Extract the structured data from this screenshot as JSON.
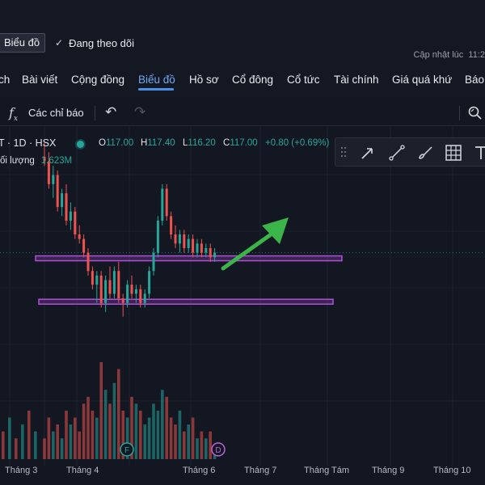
{
  "header": {
    "chart_button": "Biểu đồ",
    "follow_label": "Đang theo dõi",
    "updated_label": "Cập nhật lúc",
    "updated_time": "11:2"
  },
  "nav": {
    "tabs": [
      {
        "label": "ch",
        "active": false
      },
      {
        "label": "Bài viết",
        "active": false
      },
      {
        "label": "Cộng đồng",
        "active": false
      },
      {
        "label": "Biểu đồ",
        "active": true
      },
      {
        "label": "Hồ sơ",
        "active": false
      },
      {
        "label": "Cổ đông",
        "active": false
      },
      {
        "label": "Cổ tức",
        "active": false
      },
      {
        "label": "Tài chính",
        "active": false
      },
      {
        "label": "Giá quá khứ",
        "active": false
      },
      {
        "label": "Báo",
        "active": false
      }
    ]
  },
  "toolbar": {
    "indicators_label": "Các chỉ báo",
    "icons": [
      "function-icon",
      "undo-icon",
      "redo-icon",
      "zoom-icon"
    ]
  },
  "legend": {
    "symbol": "T · 1D · HSX",
    "open_label": "O",
    "open": "117.00",
    "high_label": "H",
    "high": "117.40",
    "low_label": "L",
    "low": "116.20",
    "close_label": "C",
    "close": "117.00",
    "change": "+0.80 (+0.69%)",
    "volume_label": "ối lượng",
    "volume": "1.623M"
  },
  "drawing_tools": [
    "arrow-tool-icon",
    "trend-line-icon",
    "brush-icon",
    "grid-icon",
    "text-icon"
  ],
  "colors": {
    "up": "#26a69a",
    "down": "#ef5350",
    "zone": "#b14fd8",
    "arrow": "#3bb44a",
    "active_tab": "#6ea9ef"
  },
  "chart_data": {
    "type": "candlestick",
    "x_labels": [
      "Tháng 3",
      "Tháng 4",
      "Tháng 6",
      "Tháng 7",
      "Tháng Tám",
      "Tháng 9",
      "Tháng 10"
    ],
    "event_markers": [
      "F",
      "D"
    ],
    "candles": [
      {
        "o": 128,
        "h": 131,
        "l": 126,
        "c": 127
      },
      {
        "o": 127,
        "h": 129,
        "l": 121,
        "c": 122
      },
      {
        "o": 122,
        "h": 126,
        "l": 119,
        "c": 124
      },
      {
        "o": 124,
        "h": 125,
        "l": 116,
        "c": 117
      },
      {
        "o": 117,
        "h": 121,
        "l": 115,
        "c": 120
      },
      {
        "o": 120,
        "h": 122,
        "l": 113,
        "c": 114
      },
      {
        "o": 114,
        "h": 118,
        "l": 112,
        "c": 116
      },
      {
        "o": 116,
        "h": 117,
        "l": 110,
        "c": 111
      },
      {
        "o": 111,
        "h": 113,
        "l": 109,
        "c": 110
      },
      {
        "o": 110,
        "h": 111,
        "l": 106,
        "c": 107
      },
      {
        "o": 107,
        "h": 108,
        "l": 102,
        "c": 103
      },
      {
        "o": 103,
        "h": 104,
        "l": 99,
        "c": 100
      },
      {
        "o": 100,
        "h": 103,
        "l": 96,
        "c": 102
      },
      {
        "o": 102,
        "h": 103,
        "l": 95,
        "c": 96
      },
      {
        "o": 96,
        "h": 102,
        "l": 94,
        "c": 101
      },
      {
        "o": 101,
        "h": 104,
        "l": 97,
        "c": 98
      },
      {
        "o": 98,
        "h": 104,
        "l": 97,
        "c": 103
      },
      {
        "o": 103,
        "h": 105,
        "l": 96,
        "c": 97
      },
      {
        "o": 97,
        "h": 98,
        "l": 93,
        "c": 96
      },
      {
        "o": 96,
        "h": 101,
        "l": 95,
        "c": 100
      },
      {
        "o": 100,
        "h": 102,
        "l": 97,
        "c": 98
      },
      {
        "o": 98,
        "h": 100,
        "l": 96,
        "c": 99
      },
      {
        "o": 99,
        "h": 100,
        "l": 95,
        "c": 96
      },
      {
        "o": 96,
        "h": 99,
        "l": 95,
        "c": 98
      },
      {
        "o": 98,
        "h": 104,
        "l": 97,
        "c": 103
      },
      {
        "o": 103,
        "h": 108,
        "l": 102,
        "c": 107
      },
      {
        "o": 107,
        "h": 115,
        "l": 106,
        "c": 114
      },
      {
        "o": 114,
        "h": 122,
        "l": 113,
        "c": 121
      },
      {
        "o": 121,
        "h": 122,
        "l": 114,
        "c": 115
      },
      {
        "o": 115,
        "h": 116,
        "l": 110,
        "c": 111
      },
      {
        "o": 111,
        "h": 113,
        "l": 108,
        "c": 109
      },
      {
        "o": 109,
        "h": 112,
        "l": 107,
        "c": 111
      },
      {
        "o": 111,
        "h": 112,
        "l": 107,
        "c": 108
      },
      {
        "o": 108,
        "h": 111,
        "l": 107,
        "c": 110
      },
      {
        "o": 110,
        "h": 111,
        "l": 106,
        "c": 107
      },
      {
        "o": 107,
        "h": 110,
        "l": 106,
        "c": 109
      },
      {
        "o": 109,
        "h": 110,
        "l": 106,
        "c": 107
      },
      {
        "o": 107,
        "h": 109,
        "l": 106,
        "c": 108
      },
      {
        "o": 108,
        "h": 109,
        "l": 105,
        "c": 106
      },
      {
        "o": 106,
        "h": 108,
        "l": 105,
        "c": 107
      }
    ],
    "volumes": [
      3,
      6,
      4,
      5,
      3,
      7,
      5,
      6,
      4,
      8,
      9,
      7,
      6,
      14,
      10,
      8,
      11,
      13,
      7,
      6,
      9,
      8,
      7,
      5,
      6,
      8,
      7,
      10,
      9,
      6,
      5,
      7,
      4,
      5,
      6,
      3,
      4,
      3,
      4,
      2
    ],
    "zones": [
      {
        "low": 105.5,
        "high": 106.3
      },
      {
        "low": 96.0,
        "high": 96.8
      }
    ],
    "last_price": 107,
    "y_range": [
      88,
      134
    ]
  }
}
